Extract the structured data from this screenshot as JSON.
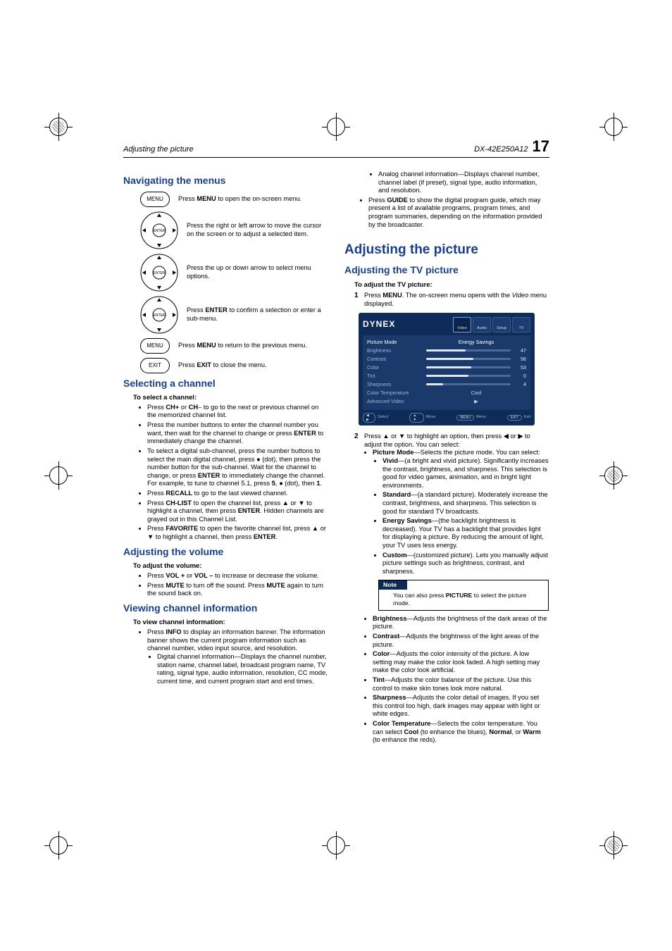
{
  "header": {
    "left": "Adjusting the picture",
    "model": "DX-42E250A12",
    "page": "17"
  },
  "nav": {
    "title": "Navigating the menus",
    "rows": [
      "Press <b>MENU</b> to open the on-screen menu.",
      "Press the right or left arrow to move the cursor on the screen or to adjust a selected item.",
      "Press the up or down arrow to select menu options.",
      "Press <b>ENTER</b> to confirm a selection or enter a sub-menu.",
      "Press <b>MENU</b> to return to the previous menu.",
      "Press <b>EXIT</b> to close the menu."
    ],
    "btn_menu": "MENU",
    "btn_enter": "ENTER",
    "btn_exit": "EXIT"
  },
  "sel": {
    "title": "Selecting a channel",
    "sub": "To select a channel:",
    "items": [
      "Press <b>CH+</b> or <b>CH</b>– to go to the next or previous channel on the memorized channel list.",
      "Press the number buttons to enter the channel number you want, then wait for the channel to change or press <b>ENTER</b> to immediately change the channel.",
      "To select a digital sub-channel, press the number buttons to select the main digital channel, press ● (dot), then press the number button for the sub-channel. Wait for the channel to change, or press <b>ENTER</b> to immediately change the channel. For example, to tune to channel 5.1, press <b>5</b>, ● (dot), then <b>1</b>.",
      "Press <b>RECALL</b> to go to the last viewed channel.",
      "Press <b>CH-LIST</b> to open the channel list, press ▲ or ▼ to highlight a channel, then press <b>ENTER</b>. Hidden channels are grayed out in this Channel List.",
      "Press <b>FAVORITE</b> to open the favorite channel list, press ▲ or ▼ to highlight a channel, then press <b>ENTER</b>."
    ]
  },
  "vol": {
    "title": "Adjusting the volume",
    "sub": "To adjust the volume:",
    "items": [
      "Press <b>VOL +</b> or <b>VOL –</b> to increase or decrease the volume.",
      "Press <b>MUTE</b> to turn off the sound. Press <b>MUTE</b> again to turn the sound back on."
    ]
  },
  "view": {
    "title": "Viewing channel information",
    "sub": "To view channel information:",
    "main": "Press <b>INFO</b> to display an information banner. The information banner shows the current program information such as channel number, video input source, and resolution.",
    "subitems": [
      "Digital channel information—Displays the channel number, station name, channel label, broadcast program name, TV rating, signal type, audio information, resolution, CC mode, current time, and current program start and end times.",
      "Analog channel information—Displays channel number, channel label (if preset), signal type, audio information, and resolution."
    ],
    "guide": "Press <b>GUIDE</b> to show the digital program guide, which may present a list of available programs, program times, and program summaries, depending on the information provided by the broadcaster."
  },
  "adj": {
    "h1": "Adjusting the picture",
    "h2": "Adjusting the TV picture",
    "sub": "To adjust the TV picture:",
    "step1": "Press <b>MENU</b>. The on-screen menu opens with the <i>Video</i> menu displayed.",
    "step2_lead": "Press ▲ or ▼ to highlight an option, then press ◀ or ▶ to adjust the option. You can select:",
    "pm_lead": "<b>Picture Mode</b>—Selects the picture mode. You can select:",
    "pm_items": [
      "<b>Vivid</b>—(a bright and vivid picture). Significantly increases the contrast, brightness, and sharpness. This selection is good for video games, animation, and in bright light environments.",
      "<b>Standard</b>—(a standard picture). Moderately increase the contrast, brightness, and sharpness. This selection is good for standard TV broadcasts.",
      "<b>Energy Savings</b>—(the backlight brightness is decreased). Your TV has a backlight that provides light for displaying a picture. By reducing the amount of light, your TV uses less energy.",
      "<b>Custom</b>—(customized picture). Lets you manually adjust picture settings such as brightness, contrast, and sharpness."
    ],
    "rest": [
      "<b>Brightness</b>—Adjusts the brightness of the dark areas of the picture.",
      "<b>Contrast</b>—Adjusts the brightness of the light areas of the picture.",
      "<b>Color</b>—Adjusts the color intensity of the picture. A low setting may make the color look faded. A high setting may make the color look artificial.",
      "<b>Tint</b>—Adjusts the color balance of the picture. Use this control to make skin tones look more natural.",
      "<b>Sharpness</b>—Adjusts the color detail of images. If you set this control too high, dark images may appear with light or white edges.",
      "<b>Color Temperature</b>—Selects the color temperature. You can select <b>Cool</b> (to enhance the blues), <b>Normal</b>, or <b>Warm</b> (to enhance the reds)."
    ]
  },
  "note": {
    "head": "Note",
    "body": "You can also press <b>PICTURE</b> to select the picture mode."
  },
  "osd": {
    "logo": "DYNEX",
    "tabs": [
      "Video",
      "Audio",
      "Setup",
      "TV"
    ],
    "rows": [
      {
        "label": "Picture Mode",
        "value_text": "Energy Savings",
        "hl": true
      },
      {
        "label": "Brightness",
        "value": 47,
        "fill": 47
      },
      {
        "label": "Contrast",
        "value": 56,
        "fill": 56
      },
      {
        "label": "Color",
        "value": 53,
        "fill": 53
      },
      {
        "label": "Tint",
        "value": 0,
        "fill": 50
      },
      {
        "label": "Sharpness",
        "value": 4,
        "fill": 20
      },
      {
        "label": "Color Temperature",
        "value_text": "Cool"
      },
      {
        "label": "Advanced Video",
        "value_text": "▶"
      }
    ],
    "foot": [
      "Select",
      "Move",
      "Menu",
      "Exit"
    ],
    "foot_pill": [
      "◀ ▶",
      "▲ ▼",
      "MENU",
      "EXIT"
    ]
  }
}
